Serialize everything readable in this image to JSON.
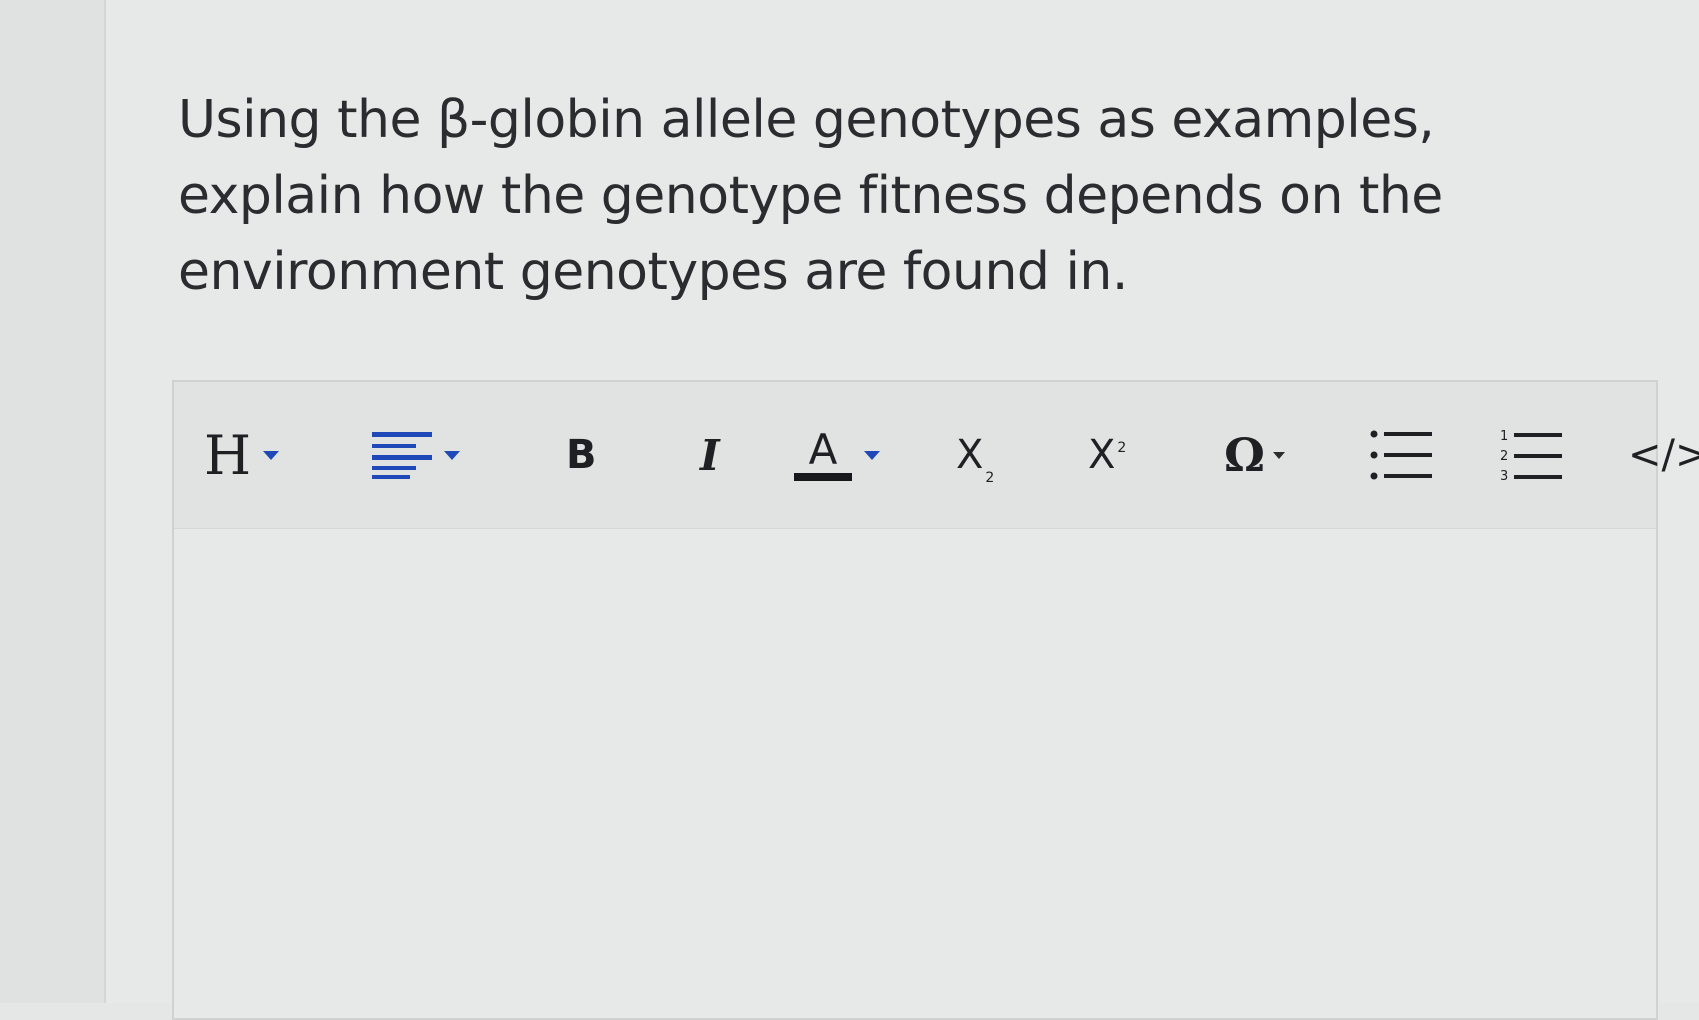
{
  "question": {
    "text": "Using the β-globin allele genotypes as examples, explain how the genotype fitness depends on the environment genotypes are found in."
  },
  "toolbar": {
    "heading_label": "H",
    "bold_label": "B",
    "italic_label": "I",
    "font_color_label": "A",
    "subscript_base": "X",
    "subscript_mark": "2",
    "superscript_base": "X",
    "superscript_mark": "2",
    "special_char_label": "Ω",
    "code_label": "</>"
  },
  "icons": {
    "heading": "heading-icon",
    "align": "align-left-icon",
    "bold": "bold-icon",
    "italic": "italic-icon",
    "font_color": "font-color-icon",
    "subscript": "subscript-icon",
    "superscript": "superscript-icon",
    "special_char": "omega-icon",
    "bullet_list": "bulleted-list-icon",
    "numbered_list": "numbered-list-icon",
    "code": "code-icon"
  },
  "colors": {
    "accent": "#1f49b8",
    "text": "#2a2c2f",
    "toolbar_bg": "#e0e3e1",
    "editor_bg": "#e6e9e7"
  }
}
